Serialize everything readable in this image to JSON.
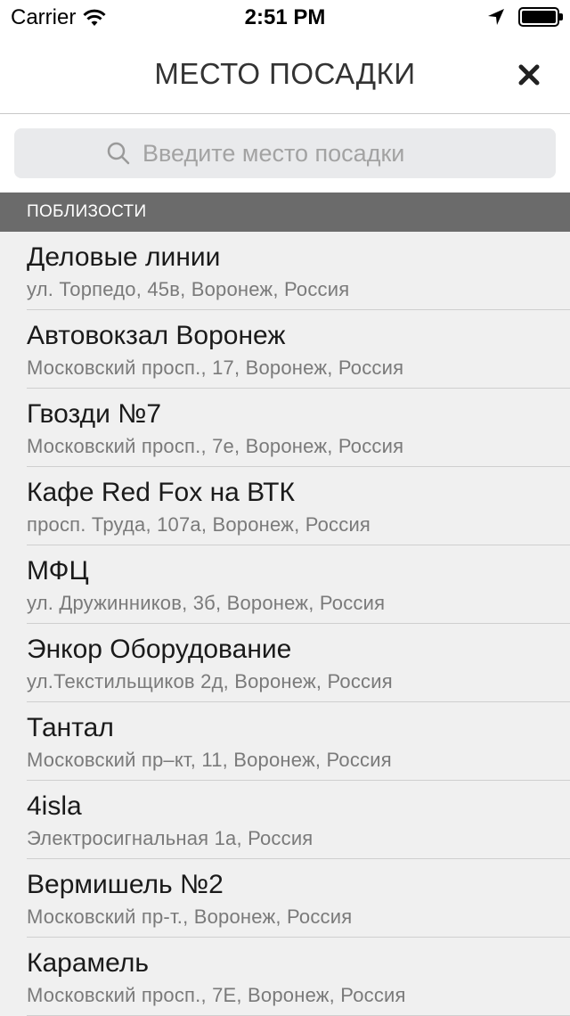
{
  "status_bar": {
    "carrier": "Carrier",
    "time": "2:51 PM"
  },
  "nav": {
    "title": "МЕСТО ПОСАДКИ"
  },
  "search": {
    "placeholder": "Введите место посадки",
    "value": ""
  },
  "section": {
    "header": "ПОБЛИЗОСТИ"
  },
  "places": [
    {
      "title": "Деловые линии",
      "address": "ул. Торпедо, 45в, Воронеж, Россия"
    },
    {
      "title": "Автовокзал Воронеж",
      "address": "Московский просп., 17, Воронеж, Россия"
    },
    {
      "title": "Гвозди №7",
      "address": "Московский просп., 7е, Воронеж, Россия"
    },
    {
      "title": "Кафе Red Fox на ВТК",
      "address": "просп. Труда, 107а, Воронеж, Россия"
    },
    {
      "title": "МФЦ",
      "address": "ул. Дружинников, 3б, Воронеж, Россия"
    },
    {
      "title": "Энкор Оборудование",
      "address": "ул.Текстильщиков 2д, Воронеж, Россия"
    },
    {
      "title": "Тантал",
      "address": "Московский пр–кт, 11, Воронеж, Россия"
    },
    {
      "title": "4isla",
      "address": "Электросигнальная 1а, Россия"
    },
    {
      "title": "Вермишель №2",
      "address": "Московский пр-т., Воронеж, Россия"
    },
    {
      "title": "Карамель",
      "address": "Московский просп., 7Е, Воронеж, Россия"
    }
  ]
}
